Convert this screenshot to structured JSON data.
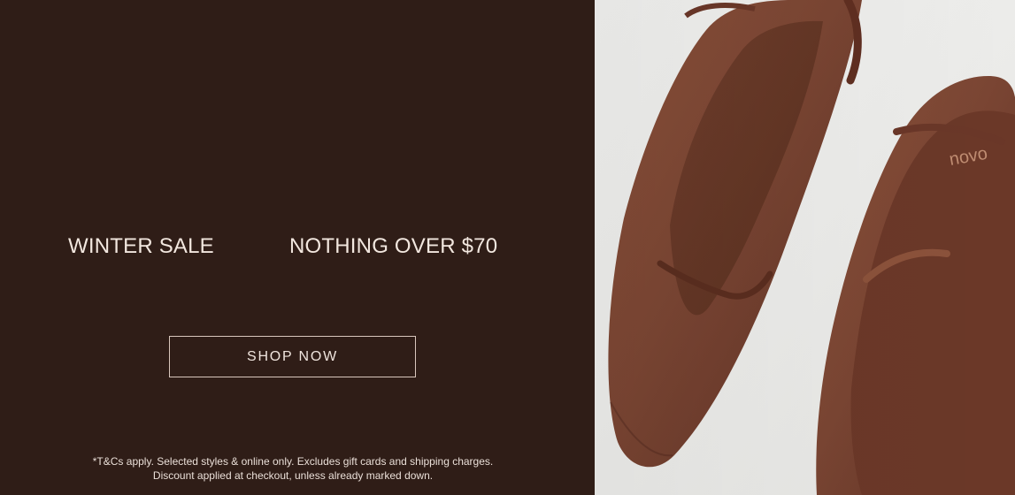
{
  "banner": {
    "headline_left": "WINTER SALE",
    "headline_right": "NOTHING OVER $70",
    "cta_label": "SHOP NOW",
    "terms_line_1": "*T&Cs apply. Selected styles & online only. Excludes gift cards and shipping charges.",
    "terms_line_2": "Discount applied at checkout, unless already marked down."
  },
  "image": {
    "subject": "brown-slingback-flats-photo",
    "brand_imprint": "novo"
  },
  "colors": {
    "left_background": "#2f1d17",
    "headline_text": "#f2e7df",
    "cta_border": "#d8c6bc",
    "right_background": "#ecece9",
    "shoe_brown": "#7a4533"
  }
}
